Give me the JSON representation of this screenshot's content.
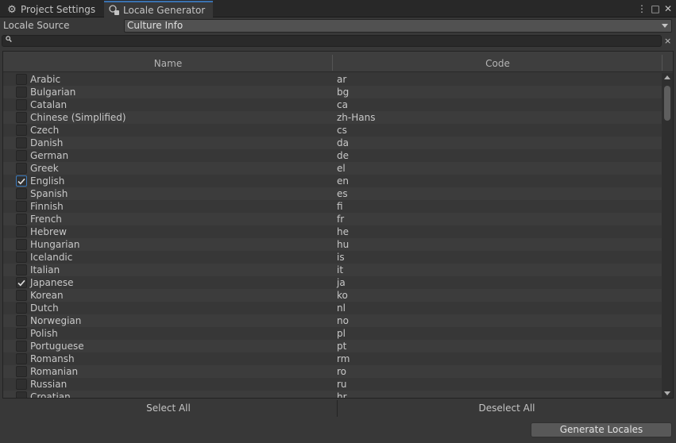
{
  "tabs": [
    {
      "label": "Project Settings",
      "icon": "gear-icon",
      "active": false
    },
    {
      "label": "Locale Generator",
      "icon": "locale-icon",
      "active": true
    }
  ],
  "window_controls": {
    "menu": "⋮",
    "maximize": "□",
    "close": "✕"
  },
  "source": {
    "label": "Locale Source",
    "value": "Culture Info"
  },
  "search": {
    "placeholder": "",
    "value": ""
  },
  "table": {
    "headers": {
      "name": "Name",
      "code": "Code"
    },
    "rows": [
      {
        "name": "Arabic",
        "code": "ar",
        "checked": false
      },
      {
        "name": "Bulgarian",
        "code": "bg",
        "checked": false
      },
      {
        "name": "Catalan",
        "code": "ca",
        "checked": false
      },
      {
        "name": "Chinese (Simplified)",
        "code": "zh-Hans",
        "checked": false
      },
      {
        "name": "Czech",
        "code": "cs",
        "checked": false
      },
      {
        "name": "Danish",
        "code": "da",
        "checked": false
      },
      {
        "name": "German",
        "code": "de",
        "checked": false
      },
      {
        "name": "Greek",
        "code": "el",
        "checked": false
      },
      {
        "name": "English",
        "code": "en",
        "checked": true,
        "focused": true
      },
      {
        "name": "Spanish",
        "code": "es",
        "checked": false
      },
      {
        "name": "Finnish",
        "code": "fi",
        "checked": false
      },
      {
        "name": "French",
        "code": "fr",
        "checked": false
      },
      {
        "name": "Hebrew",
        "code": "he",
        "checked": false
      },
      {
        "name": "Hungarian",
        "code": "hu",
        "checked": false
      },
      {
        "name": "Icelandic",
        "code": "is",
        "checked": false
      },
      {
        "name": "Italian",
        "code": "it",
        "checked": false
      },
      {
        "name": "Japanese",
        "code": "ja",
        "checked": true
      },
      {
        "name": "Korean",
        "code": "ko",
        "checked": false
      },
      {
        "name": "Dutch",
        "code": "nl",
        "checked": false
      },
      {
        "name": "Norwegian",
        "code": "no",
        "checked": false
      },
      {
        "name": "Polish",
        "code": "pl",
        "checked": false
      },
      {
        "name": "Portuguese",
        "code": "pt",
        "checked": false
      },
      {
        "name": "Romansh",
        "code": "rm",
        "checked": false
      },
      {
        "name": "Romanian",
        "code": "ro",
        "checked": false
      },
      {
        "name": "Russian",
        "code": "ru",
        "checked": false
      },
      {
        "name": "Croatian",
        "code": "hr",
        "checked": false
      }
    ]
  },
  "buttons": {
    "select_all": "Select All",
    "deselect_all": "Deselect All",
    "generate": "Generate Locales"
  },
  "colors": {
    "accent": "#3a72b0",
    "background": "#383838"
  }
}
